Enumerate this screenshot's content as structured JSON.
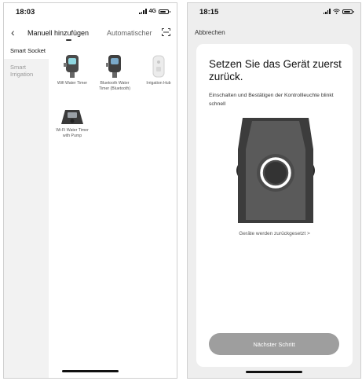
{
  "left": {
    "status": {
      "time": "18:03",
      "network": "4G"
    },
    "tabs": [
      {
        "label": "Manuell hinzufügen"
      },
      {
        "label": "Automatischer"
      }
    ],
    "sidebar": [
      {
        "label": "Smart Socket",
        "active": true
      },
      {
        "label": "Smart Irrigation",
        "active": false
      }
    ],
    "devices": [
      {
        "label": "Wifi Water Timer",
        "icon": "water-timer-icon"
      },
      {
        "label": "Bluetooth Water Timer (Bluetooth)",
        "icon": "bluetooth-water-timer-icon"
      },
      {
        "label": "Irrigation Hub",
        "icon": "irrigation-hub-icon"
      },
      {
        "label": "Wi-Fi Water Timer with Pump",
        "icon": "water-timer-pump-icon"
      }
    ]
  },
  "right": {
    "status": {
      "time": "18:15"
    },
    "cancel": "Abbrechen",
    "title": "Setzen Sie das Gerät zuerst zurück.",
    "description": "Einschalten und Bestätigen der Kontrollleuchte blinkt schnell",
    "reset_link": "Geräte werden zurückgesetzt >",
    "next_button": "Nächster Schritt",
    "colors": {
      "button": "#9e9e9e",
      "device_body": "#3c3c3c",
      "device_panel": "#5a5a5a",
      "ring": "#ffffff"
    }
  }
}
